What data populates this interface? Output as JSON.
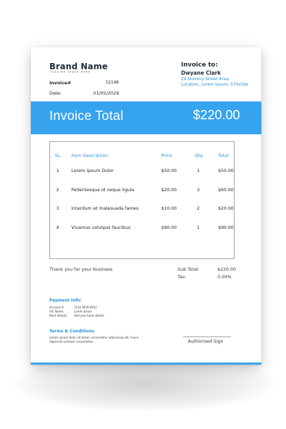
{
  "brand": {
    "name": "Brand Name",
    "tagline": "TAGLINE SPACE HERE"
  },
  "invoice_meta": {
    "number_label": "Invoice#",
    "number_value": "52148",
    "date_label": "Date:",
    "date_value": "01/05/2029"
  },
  "invoice_to": {
    "title": "Invoice to:",
    "name": "Dwyane Clark",
    "address": "24 Dummy Street Area, Location, Lorem Ipsum, 570x59x"
  },
  "band": {
    "title": "Invoice Total",
    "amount": "$220.00",
    "color": "#36a3ef"
  },
  "table": {
    "headers": {
      "sl": "SL.",
      "description": "Item Description",
      "price": "Price",
      "qty": "Qty.",
      "total": "Total"
    },
    "rows": [
      {
        "sl": "1",
        "description": "Lorem Ipsum Dolor",
        "price": "$50.00",
        "qty": "1",
        "total": "$50.00"
      },
      {
        "sl": "2",
        "description": "Pellentesque id neque ligula",
        "price": "$20.00",
        "qty": "3",
        "total": "$60.00"
      },
      {
        "sl": "3",
        "description": "Interdum et malesuada fames",
        "price": "$10.00",
        "qty": "2",
        "total": "$20.00"
      },
      {
        "sl": "4",
        "description": "Vivamus volutpat faucibus",
        "price": "$90.00",
        "qty": "1",
        "total": "$90.00"
      }
    ]
  },
  "thanks": "Thank you for your business",
  "summary": {
    "subtotal_label": "Sub Total:",
    "subtotal_value": "$220.00",
    "tax_label": "Tax:",
    "tax_value": "0.00%"
  },
  "payment": {
    "title": "Payment Info:",
    "account_label": "Account #:",
    "account_value": "1234 5678 9012",
    "ac_name_label": "A/C Name:",
    "ac_name_value": "Lorem Ipsum",
    "bank_label": "Bank Details:",
    "bank_value": "Add your bank details"
  },
  "terms": {
    "title": "Terms & Conditions",
    "text": "Lorem ipsum dolor sit amet, consectetur adipiscing elit. Fusce dignissim pretium consectetur."
  },
  "signature": {
    "label": "Authorised Sign"
  }
}
